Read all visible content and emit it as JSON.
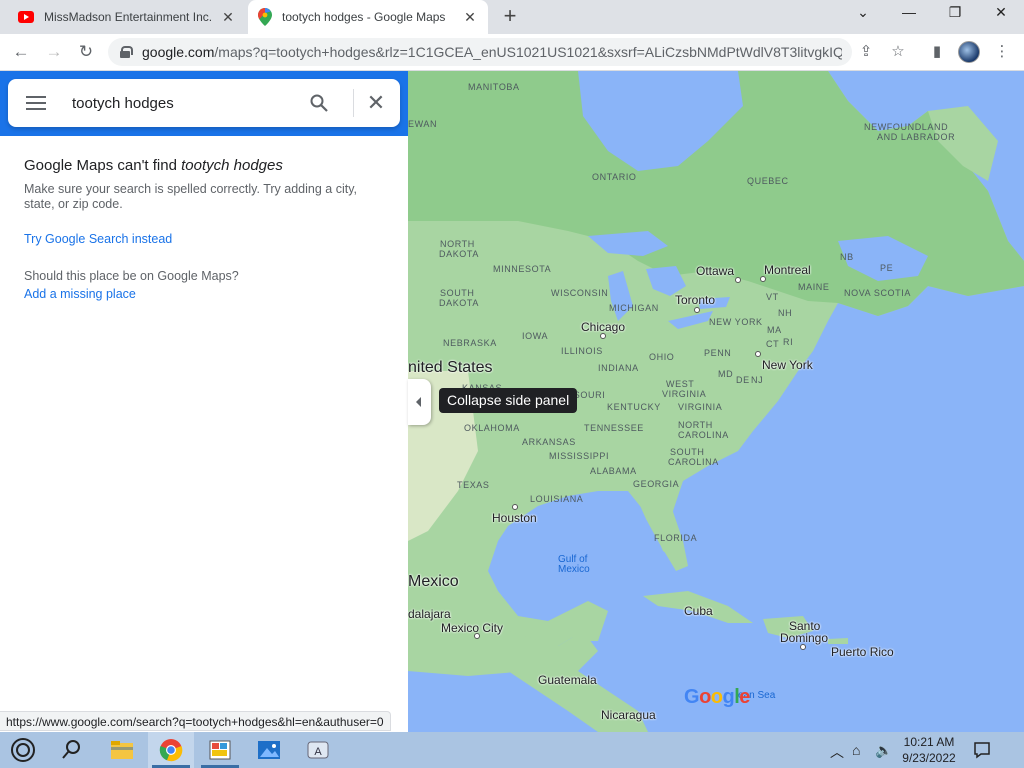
{
  "browser": {
    "tabs": [
      {
        "title": "MissMadson Entertainment Inc. -",
        "icon": "youtube-icon",
        "active": false
      },
      {
        "title": "tootych hodges - Google Maps",
        "icon": "google-maps-pin-icon",
        "active": true
      }
    ],
    "new_tab_icon": "plus-icon",
    "window_controls": {
      "dropdown": "chevron-down-icon",
      "minimize": "minimize-icon",
      "restore": "restore-icon",
      "close": "close-icon"
    },
    "url_host": "google.com",
    "url_rest": "/maps?q=tootych+hodges&rlz=1C1GCEA_enUS1021US1021&sxsrf=ALiCzsbNMdPtWdlV8T3litvgkIQ...",
    "toolbar_icons": [
      "share-icon",
      "star-icon",
      "side-panel-icon",
      "profile-avatar",
      "more-vert-icon"
    ]
  },
  "search": {
    "query": "tootych hodges",
    "menu_icon": "menu-icon",
    "search_icon": "search-icon",
    "clear_icon": "close-icon"
  },
  "results": {
    "cant_find_prefix": "Google Maps can't find ",
    "cant_find_query": "tootych hodges",
    "hint": "Make sure your search is spelled correctly. Try adding a city, state, or zip code.",
    "try_google_link": "Try Google Search instead",
    "should_place": "Should this place be on Google Maps?",
    "add_missing_link": "Add a missing place"
  },
  "status_url": "https://www.google.com/search?q=tootych+hodges&hl=en&authuser=0",
  "map": {
    "tooltip": "Collapse side panel",
    "regions": [
      "MANITOBA",
      "EWAN",
      "ONTARIO",
      "QUEBEC",
      "NEWFOUNDLAND",
      "AND LABRADOR",
      "NORTH",
      "DAKOTA",
      "SOUTH",
      "DAKOTA",
      "MINNESOTA",
      "WISCONSIN",
      "MICHIGAN",
      "IOWA",
      "NEBRASKA",
      "ILLINOIS",
      "INDIANA",
      "OHIO",
      "PENN",
      "KANSAS",
      "MISSOURI",
      "KENTUCKY",
      "WEST",
      "VIRGINIA",
      "VIRGINIA",
      "OKLAHOMA",
      "ARKANSAS",
      "TENNESSEE",
      "NORTH",
      "CAROLINA",
      "SOUTH",
      "CAROLINA",
      "MISSISSIPPI",
      "ALABAMA",
      "GEORGIA",
      "TEXAS",
      "LOUISIANA",
      "FLORIDA",
      "NB",
      "PE",
      "NOVA SCOTIA",
      "MAINE",
      "VT",
      "NH",
      "MA",
      "CT",
      "RI",
      "MD",
      "DE",
      "NJ",
      "NEW YORK"
    ],
    "cities": [
      "Ottawa",
      "Montreal",
      "Toronto",
      "Chicago",
      "New York",
      "Houston",
      "Mexico City",
      "Cuba",
      "Santo",
      "Domingo",
      "Puerto Rico",
      "Guatemala",
      "Nicaragua",
      "dalajara"
    ],
    "countries": [
      "nited States",
      "Mexico"
    ],
    "water": [
      "Gulf of",
      "Mexico",
      "ean Sea"
    ],
    "logo": "Google",
    "collapse_handle_icon": "chevron-left-icon"
  },
  "taskbar": {
    "start_icon": "start-icon",
    "search_icon": "search-icon",
    "apps": [
      "file-explorer-icon",
      "chrome-icon",
      "paint-icon",
      "photos-icon",
      "app-icon"
    ],
    "tray_icons": [
      "chevron-up-icon",
      "network-icon",
      "volume-icon",
      "notification-icon"
    ],
    "time": "10:21 AM",
    "date": "9/23/2022"
  }
}
